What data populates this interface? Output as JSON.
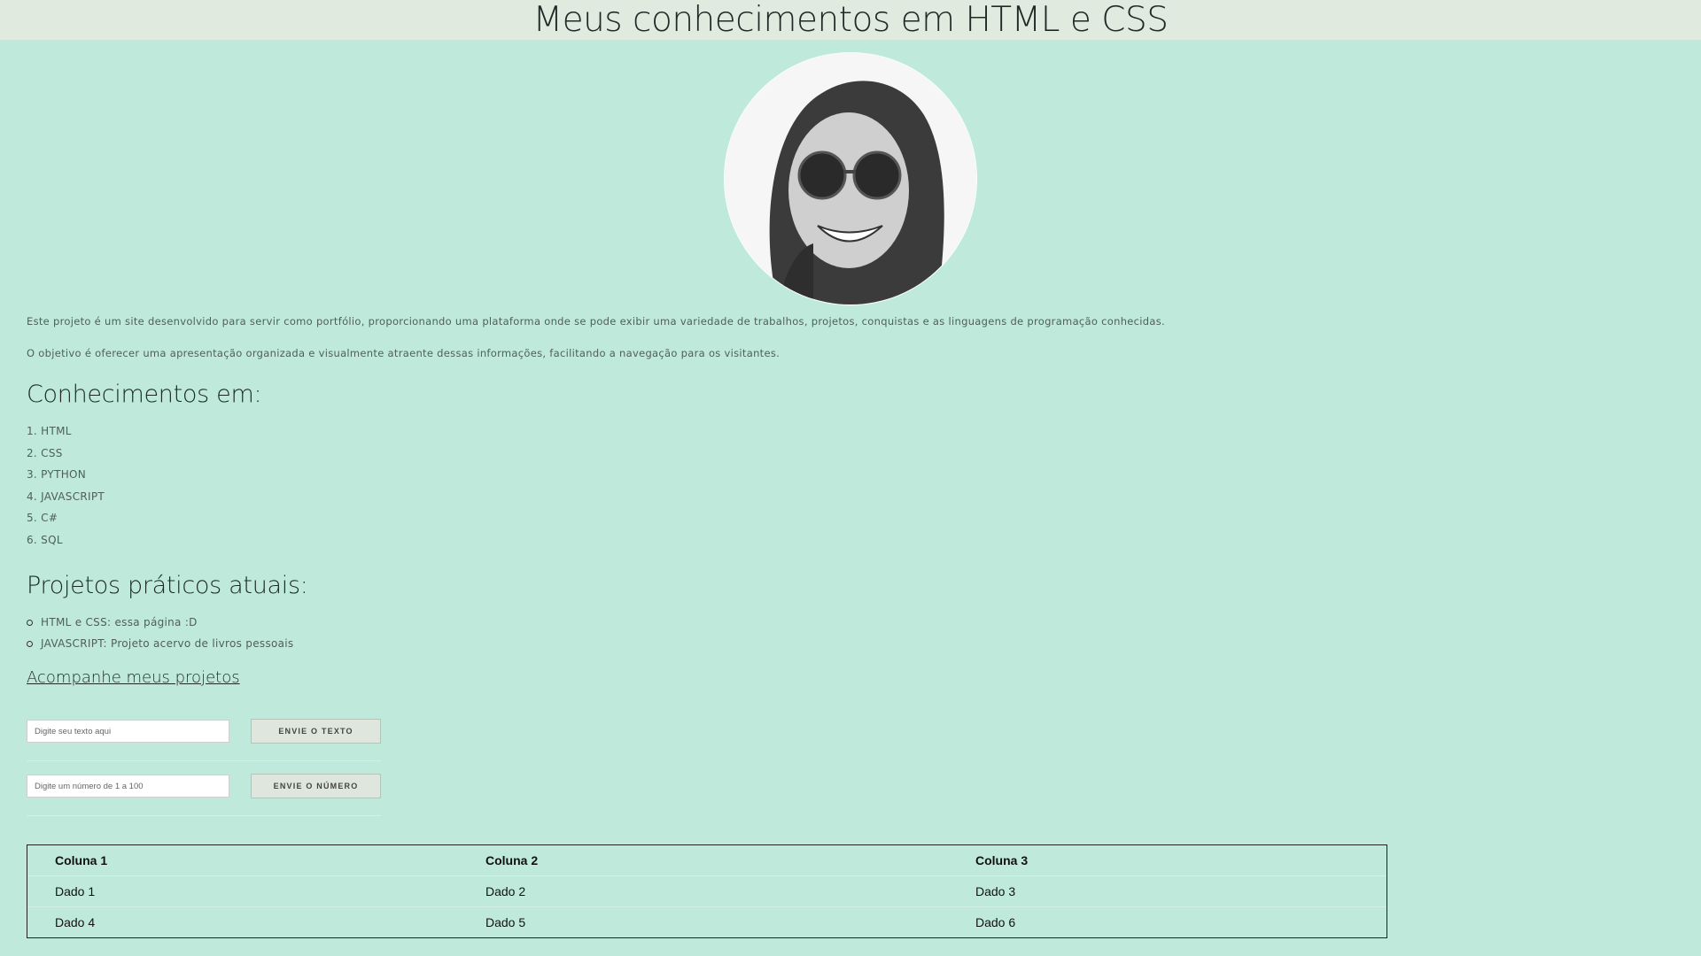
{
  "header": {
    "title": "Meus conhecimentos em HTML e CSS"
  },
  "intro": {
    "p1": "Este projeto é um site desenvolvido para servir como portfólio, proporcionando uma plataforma onde se pode exibir uma variedade de trabalhos, projetos, conquistas e as linguagens de programação conhecidas.",
    "p2": "O objetivo é oferecer uma apresentação organizada e visualmente atraente dessas informações, facilitando a navegação para os visitantes."
  },
  "knowledge": {
    "heading": "Conhecimentos em:",
    "items": [
      "1. HTML",
      "2. CSS",
      "3. PYTHON",
      "4. JAVASCRIPT",
      "5. C#",
      "6. SQL"
    ]
  },
  "projects": {
    "heading": "Projetos práticos atuais:",
    "items": [
      "HTML e CSS: essa página :D",
      "JAVASCRIPT: Projeto acervo de livros pessoais"
    ]
  },
  "link": {
    "label": "Acompanhe meus projetos"
  },
  "form_text": {
    "placeholder": "Digite seu texto aqui",
    "button": "ENVIE O TEXTO"
  },
  "form_number": {
    "placeholder": "Digite um número de 1 a 100",
    "button": "ENVIE O NÚMERO"
  },
  "table": {
    "headers": [
      "Coluna 1",
      "Coluna 2",
      "Coluna 3"
    ],
    "rows": [
      [
        "Dado 1",
        "Dado 2",
        "Dado 3"
      ],
      [
        "Dado 4",
        "Dado 5",
        "Dado 6"
      ]
    ]
  },
  "colors": {
    "background": "#bfeadb",
    "header_bg": "#e0eadf"
  },
  "icons": {
    "avatar": "profile-photo"
  }
}
